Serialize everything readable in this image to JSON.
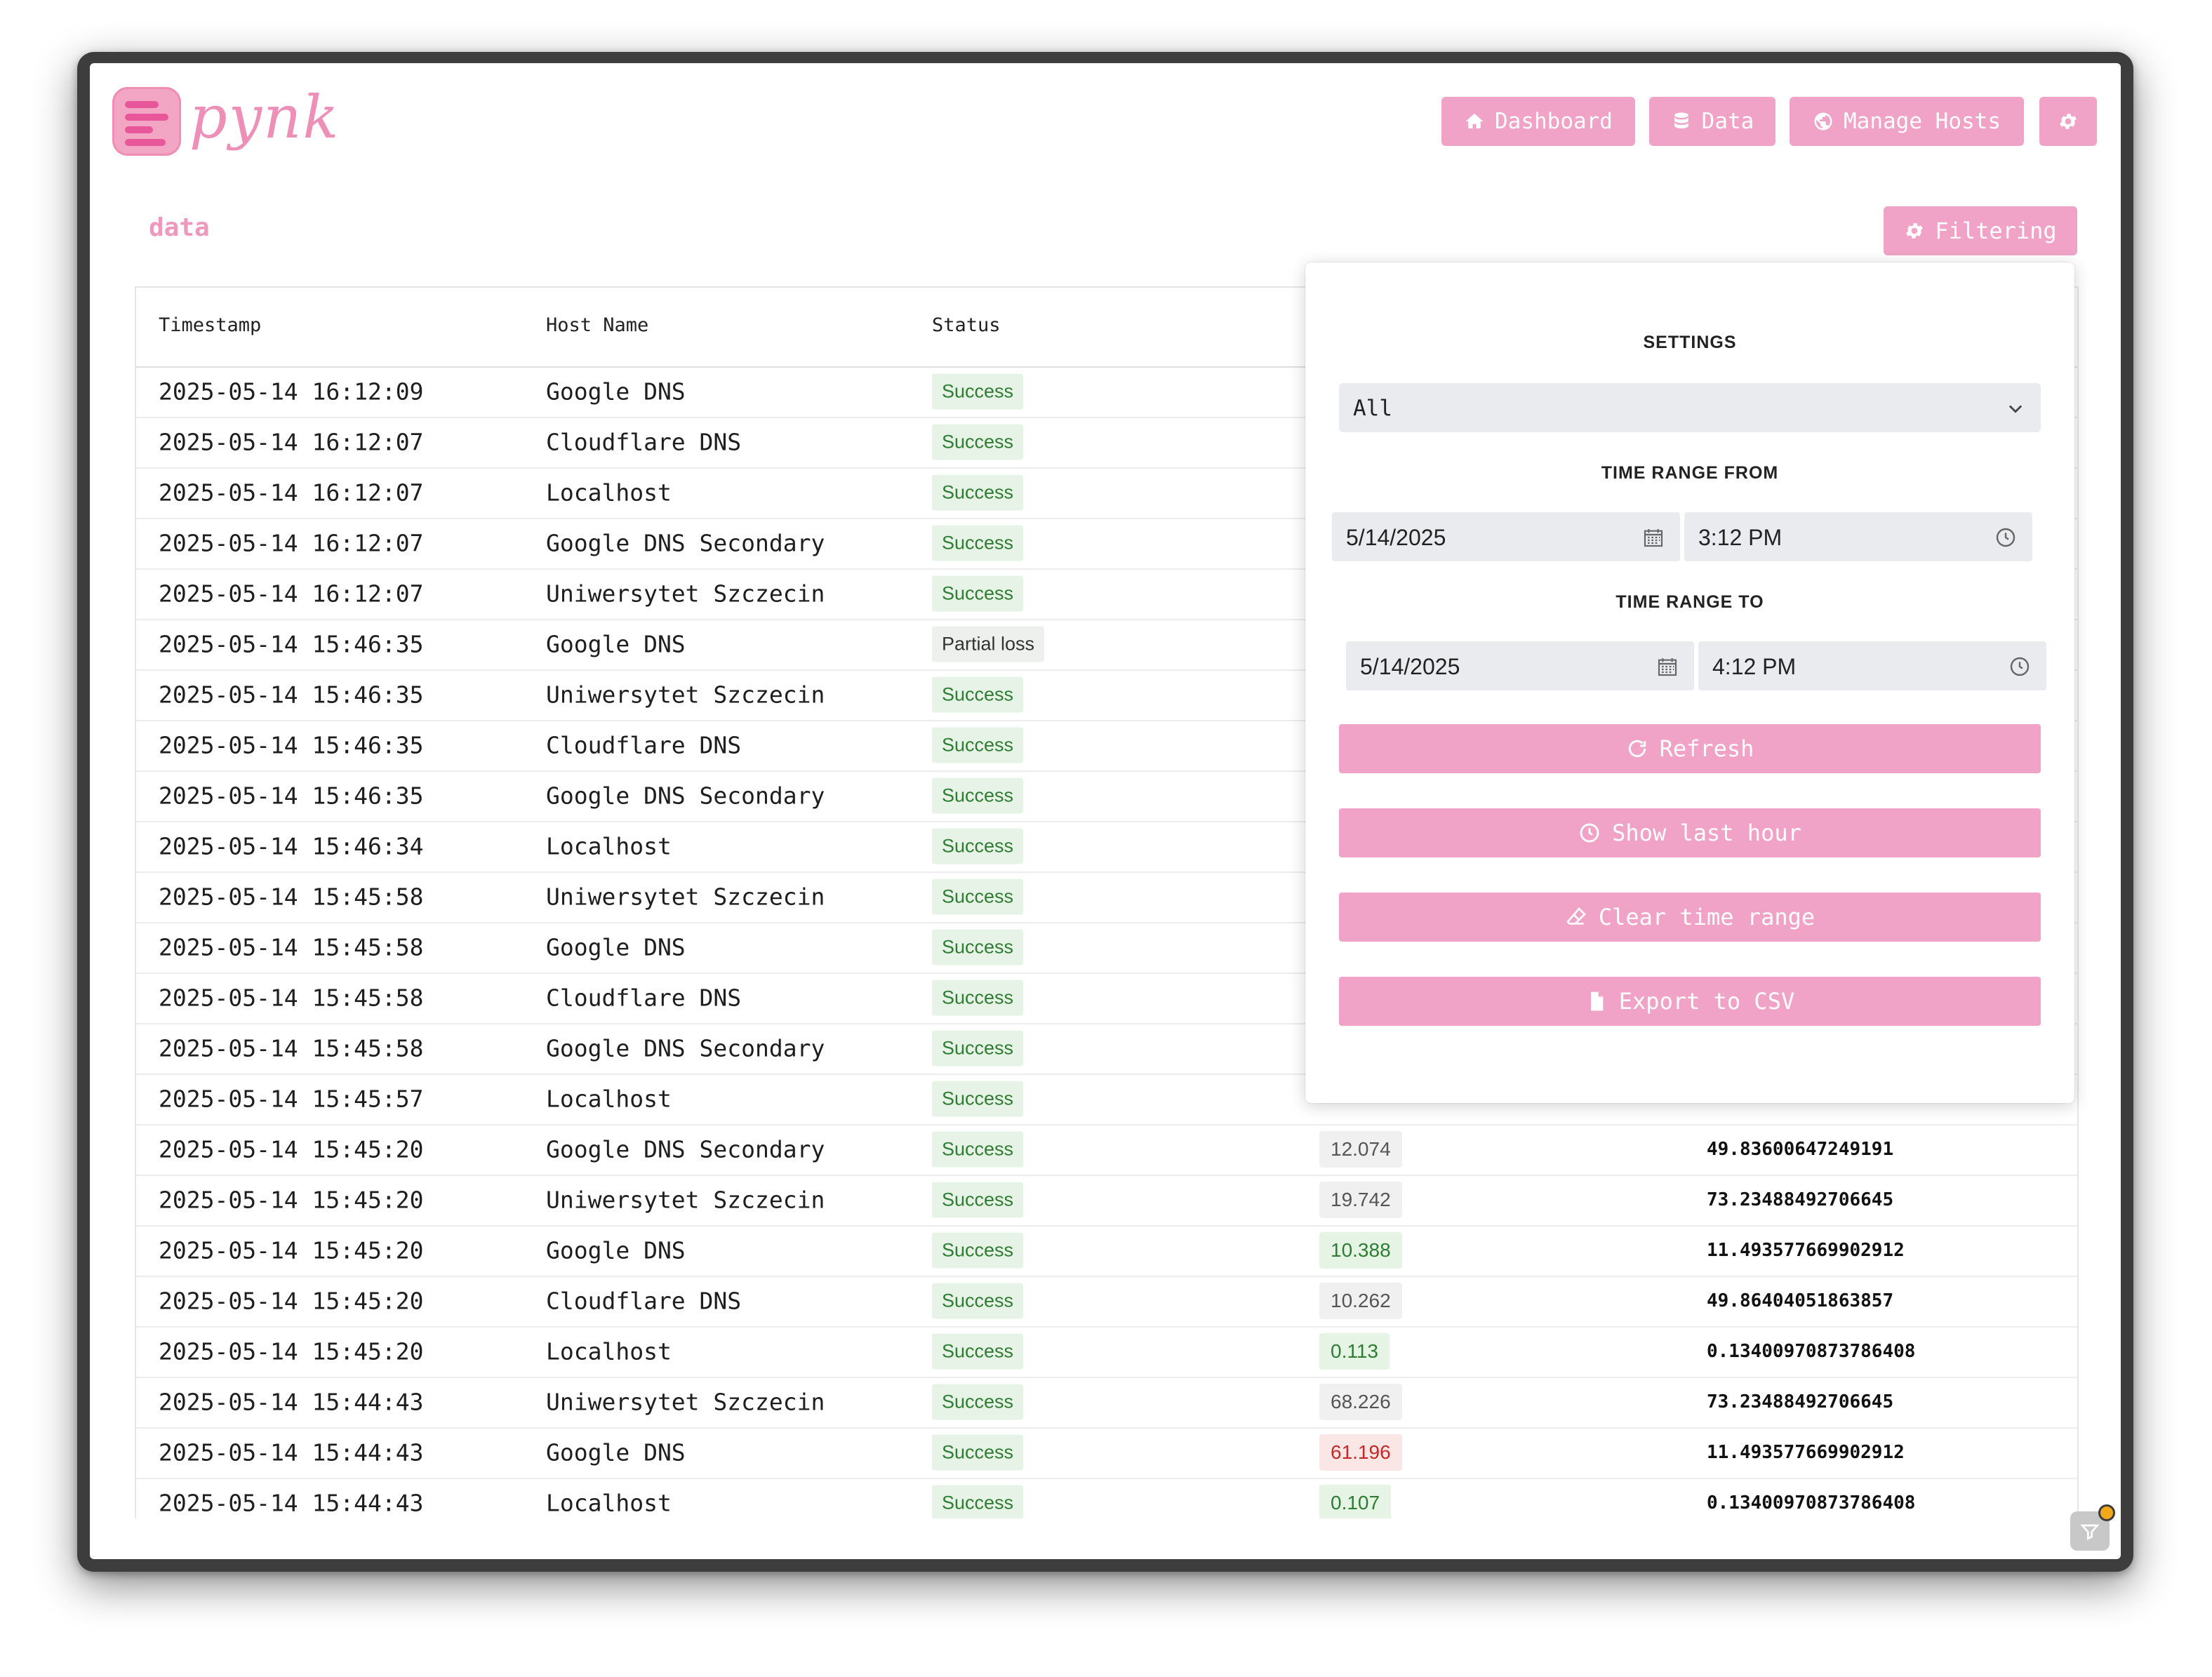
{
  "app": {
    "logo_text": "pynk",
    "page_title": "data"
  },
  "nav": {
    "dashboard": "Dashboard",
    "data": "Data",
    "manage_hosts": "Manage Hosts"
  },
  "filter_button": "Filtering",
  "table": {
    "headers": [
      "Timestamp",
      "Host Name",
      "Status"
    ],
    "rows": [
      {
        "ts": "2025-05-14 16:12:09",
        "host": "Google DNS",
        "status": "Success",
        "latency": "",
        "loss": ""
      },
      {
        "ts": "2025-05-14 16:12:07",
        "host": "Cloudflare DNS",
        "status": "Success",
        "latency": "",
        "loss": ""
      },
      {
        "ts": "2025-05-14 16:12:07",
        "host": "Localhost",
        "status": "Success",
        "latency": "",
        "loss": ""
      },
      {
        "ts": "2025-05-14 16:12:07",
        "host": "Google DNS Secondary",
        "status": "Success",
        "latency": "",
        "loss": ""
      },
      {
        "ts": "2025-05-14 16:12:07",
        "host": "Uniwersytet Szczecin",
        "status": "Success",
        "latency": "",
        "loss": ""
      },
      {
        "ts": "2025-05-14 15:46:35",
        "host": "Google DNS",
        "status": "Partial loss",
        "latency": "",
        "loss": ""
      },
      {
        "ts": "2025-05-14 15:46:35",
        "host": "Uniwersytet Szczecin",
        "status": "Success",
        "latency": "",
        "loss": ""
      },
      {
        "ts": "2025-05-14 15:46:35",
        "host": "Cloudflare DNS",
        "status": "Success",
        "latency": "",
        "loss": ""
      },
      {
        "ts": "2025-05-14 15:46:35",
        "host": "Google DNS Secondary",
        "status": "Success",
        "latency": "",
        "loss": ""
      },
      {
        "ts": "2025-05-14 15:46:34",
        "host": "Localhost",
        "status": "Success",
        "latency": "",
        "loss": ""
      },
      {
        "ts": "2025-05-14 15:45:58",
        "host": "Uniwersytet Szczecin",
        "status": "Success",
        "latency": "",
        "loss": ""
      },
      {
        "ts": "2025-05-14 15:45:58",
        "host": "Google DNS",
        "status": "Success",
        "latency": "",
        "loss": ""
      },
      {
        "ts": "2025-05-14 15:45:58",
        "host": "Cloudflare DNS",
        "status": "Success",
        "latency": "",
        "loss": ""
      },
      {
        "ts": "2025-05-14 15:45:58",
        "host": "Google DNS Secondary",
        "status": "Success",
        "latency": "",
        "loss": ""
      },
      {
        "ts": "2025-05-14 15:45:57",
        "host": "Localhost",
        "status": "Success",
        "latency": "",
        "loss": ""
      },
      {
        "ts": "2025-05-14 15:45:20",
        "host": "Google DNS Secondary",
        "status": "Success",
        "latency": "12.074",
        "latency_style": "gray",
        "loss": "49.83600647249191"
      },
      {
        "ts": "2025-05-14 15:45:20",
        "host": "Uniwersytet Szczecin",
        "status": "Success",
        "latency": "19.742",
        "latency_style": "gray",
        "loss": "73.23488492706645"
      },
      {
        "ts": "2025-05-14 15:45:20",
        "host": "Google DNS",
        "status": "Success",
        "latency": "10.388",
        "latency_style": "green",
        "loss": "11.493577669902912"
      },
      {
        "ts": "2025-05-14 15:45:20",
        "host": "Cloudflare DNS",
        "status": "Success",
        "latency": "10.262",
        "latency_style": "gray",
        "loss": "49.86404051863857"
      },
      {
        "ts": "2025-05-14 15:45:20",
        "host": "Localhost",
        "status": "Success",
        "latency": "0.113",
        "latency_style": "green",
        "loss": "0.13400970873786408"
      },
      {
        "ts": "2025-05-14 15:44:43",
        "host": "Uniwersytet Szczecin",
        "status": "Success",
        "latency": "68.226",
        "latency_style": "gray",
        "loss": "73.23488492706645"
      },
      {
        "ts": "2025-05-14 15:44:43",
        "host": "Google DNS",
        "status": "Success",
        "latency": "61.196",
        "latency_style": "red",
        "loss": "11.493577669902912"
      },
      {
        "ts": "2025-05-14 15:44:43",
        "host": "Localhost",
        "status": "Success",
        "latency": "0.107",
        "latency_style": "green",
        "loss": "0.13400970873786408"
      }
    ]
  },
  "filter_panel": {
    "settings_label": "SETTINGS",
    "settings_value": "All",
    "from_label": "TIME RANGE FROM",
    "from_date": "5/14/2025",
    "from_time": "3:12 PM",
    "to_label": "TIME RANGE TO",
    "to_date": "5/14/2025",
    "to_time": "4:12 PM",
    "refresh": "Refresh",
    "show_last_hour": "Show last hour",
    "clear_time_range": "Clear time range",
    "export_csv": "Export to CSV"
  },
  "colors": {
    "accent": "#f0a3c6",
    "success_bg": "#e7f3e7",
    "success_fg": "#2e7d32",
    "danger_fg": "#c62828"
  },
  "icons": [
    "home-icon",
    "database-icon",
    "globe-icon",
    "gear-icon",
    "calendar-icon",
    "clock-icon",
    "refresh-icon",
    "eraser-icon",
    "file-icon",
    "chevron-down-icon",
    "filter-icon"
  ]
}
